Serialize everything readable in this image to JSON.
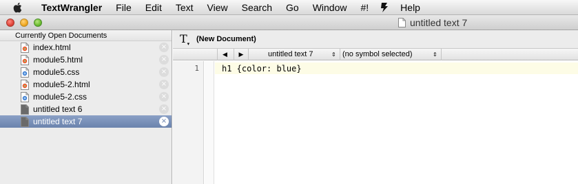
{
  "menubar": {
    "app_name": "TextWrangler",
    "items": [
      "File",
      "Edit",
      "Text",
      "View",
      "Search",
      "Go",
      "Window",
      "#!",
      "Help"
    ]
  },
  "window": {
    "title": "untitled text 7"
  },
  "sidebar": {
    "header": "Currently Open Documents",
    "documents": [
      {
        "name": "index.html",
        "icon": "html-file-icon"
      },
      {
        "name": "module5.html",
        "icon": "html-file-icon"
      },
      {
        "name": "module5.css",
        "icon": "css-file-icon"
      },
      {
        "name": "module5-2.html",
        "icon": "html-file-icon"
      },
      {
        "name": "module5-2.css",
        "icon": "css-file-icon"
      },
      {
        "name": "untitled text 6",
        "icon": "text-file-icon"
      },
      {
        "name": "untitled text 7",
        "icon": "text-file-icon",
        "selected": true
      }
    ],
    "close_glyph": "×"
  },
  "editor": {
    "doc_header": "(New Document)",
    "text_tool_glyph": "T",
    "nav_back": "◀",
    "nav_forward": "▶",
    "file_popup": "untitled text 7",
    "symbol_popup": "(no symbol selected)",
    "popup_arrows": "⇕",
    "line_numbers": [
      "1"
    ],
    "lines": [
      "h1 {color: blue}"
    ]
  },
  "colors": {
    "selection": "#7188b2",
    "current_line": "#fdfce6"
  }
}
